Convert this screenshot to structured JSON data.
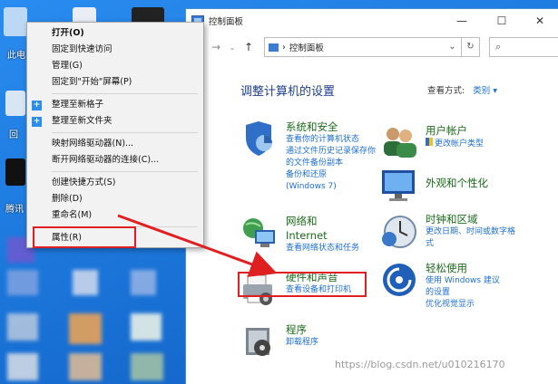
{
  "context_menu": {
    "items": [
      {
        "label": "打开(O)",
        "bold": true
      },
      {
        "label": "固定到快速访问"
      },
      {
        "label": "管理(G)"
      },
      {
        "label": "固定到\"开始\"屏幕(P)"
      },
      {
        "label": "整理至新格子",
        "icon": true
      },
      {
        "label": "整理至新文件夹",
        "icon": true
      },
      {
        "label": "映射网络驱动器(N)..."
      },
      {
        "label": "断开网络驱动器的连接(C)..."
      },
      {
        "label": "创建快捷方式(S)"
      },
      {
        "label": "删除(D)"
      },
      {
        "label": "重命名(M)"
      },
      {
        "label": "属性(R)"
      }
    ]
  },
  "desktop": {
    "labels": [
      "此电",
      "回",
      "腾讯"
    ]
  },
  "window": {
    "title": "控制面板",
    "controls": {
      "minimize": "—",
      "maximize": "☐",
      "close": "✕"
    },
    "address": {
      "breadcrumb": "控制面板",
      "separator": "›"
    },
    "heading": "调整计算机的设置",
    "view_by_label": "查看方式:",
    "view_by_value": "类别 ▾",
    "categories": {
      "system": {
        "title": "系统和安全",
        "links": [
          "查看你的计算机状态",
          "通过文件历史记录保存你",
          "的文件备份副本",
          "备份和还原",
          "(Windows 7)"
        ]
      },
      "user": {
        "title": "用户帐户",
        "links": [
          "更改帐户类型"
        ]
      },
      "network": {
        "title1": "网络和",
        "title2": "Internet",
        "links": [
          "查看网络状态和任务"
        ]
      },
      "appearance": {
        "title": "外观和个性化"
      },
      "hardware": {
        "title": "硬件和声音",
        "links": [
          "查看设备和打印机"
        ]
      },
      "clock": {
        "title": "时钟和区域",
        "links": [
          "更改日期、时间或数字格",
          "式"
        ]
      },
      "programs": {
        "title": "程序",
        "links": [
          "卸载程序"
        ]
      },
      "ease": {
        "title": "轻松使用",
        "links": [
          "使用 Windows 建议",
          "的设置",
          "优化视觉显示"
        ]
      }
    }
  },
  "watermark": "https://blog.csdn.net/u010216170",
  "colors": {
    "accent": "#1e6fd0",
    "highlight": "#e02020",
    "desktop": "#1f7fe0"
  }
}
